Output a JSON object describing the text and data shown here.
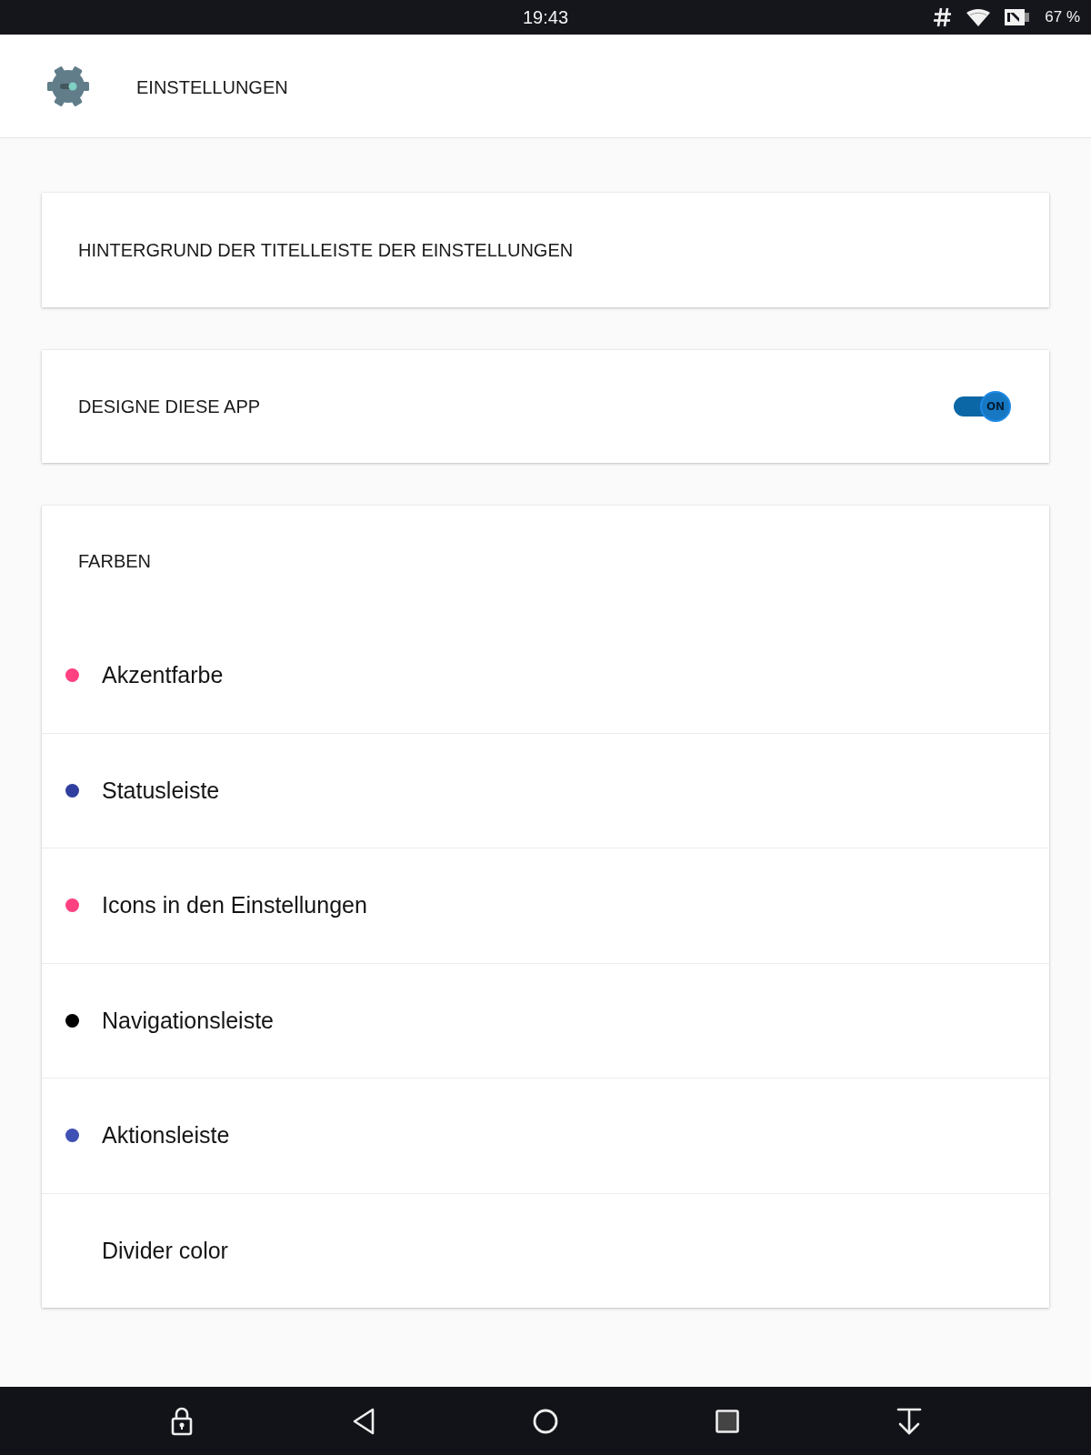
{
  "status_bar": {
    "time": "19:43",
    "battery": "67 %"
  },
  "app_bar": {
    "title": "EINSTELLUNGEN"
  },
  "cards": [
    {
      "kind": "title",
      "title": "HINTERGRUND DER TITELLEISTE DER EINSTELLUNGEN"
    },
    {
      "kind": "switch",
      "title": "DESIGNE DIESE APP",
      "switch": {
        "on": true,
        "label": "ON"
      }
    },
    {
      "kind": "list",
      "title": "FARBEN",
      "items": [
        {
          "label": "Akzentfarbe",
          "color": "#ff4081"
        },
        {
          "label": "Statusleiste",
          "color": "#303f9f"
        },
        {
          "label": "Icons in den Einstellungen",
          "color": "#ff4081"
        },
        {
          "label": "Navigationsleiste",
          "color": "#000000"
        },
        {
          "label": "Aktionsleiste",
          "color": "#3f51b5"
        },
        {
          "label": "Divider color"
        }
      ]
    }
  ]
}
